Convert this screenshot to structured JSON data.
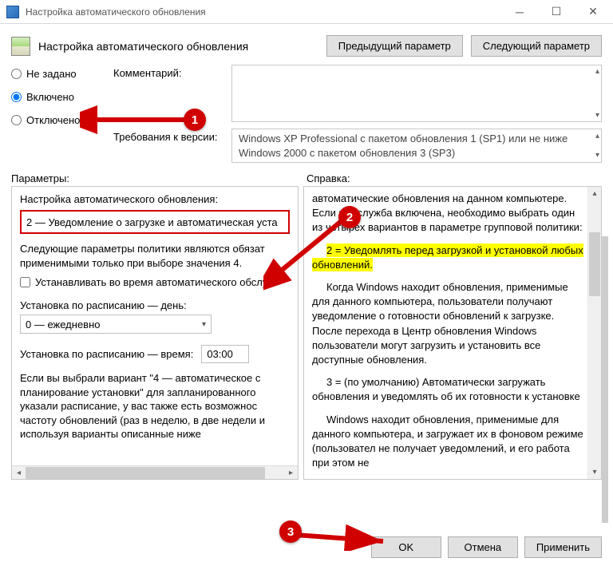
{
  "window": {
    "title": "Настройка автоматического обновления"
  },
  "header": {
    "policy_title": "Настройка автоматического обновления",
    "prev_button": "Предыдущий параметр",
    "next_button": "Следующий параметр"
  },
  "state": {
    "not_configured": "Не задано",
    "enabled": "Включено",
    "disabled": "Отключено",
    "selected": "enabled"
  },
  "fields": {
    "comment_label": "Комментарий:",
    "supported_label": "Требования к версии:",
    "supported_line1": "Windows XP Professional с пакетом обновления 1 (SP1) или не ниже",
    "supported_line2": "Windows 2000 с пакетом обновления 3 (SP3)"
  },
  "panes": {
    "options_label": "Параметры:",
    "help_label": "Справка:"
  },
  "options": {
    "dropdown_label": "Настройка автоматического обновления:",
    "dropdown_value": "2 — Уведомление о загрузке и автоматическая уста",
    "desc_line": "Следующие параметры политики являются обязат применимыми только при выборе значения 4.",
    "checkbox_label": "Устанавливать во время автоматического обслу",
    "day_label": "Установка по расписанию — день:",
    "day_value": "0 — ежедневно",
    "time_label": "Установка по расписанию — время:",
    "time_value": "03:00",
    "long_desc": "Если вы выбрали вариант \"4 — автоматическое с планирование установки\" для запланированного указали расписание, у вас также есть возможнос частоту обновлений (раз в неделю, в две недели и используя варианты  описанные ниже"
  },
  "help": {
    "p1": "автоматические обновления на данном компьютере. Если эта служба включена, необходимо выбрать один из четырех вариантов в параметре групповой политики:",
    "hl": "2 = Уведомлять перед загрузкой и установкой любых обновлений.",
    "p2": "Когда Windows находит обновления, применимые для данного компьютера, пользователи получают уведомление о готовности обновлений к загрузке. После перехода в Центр обновления Windows пользователи могут загрузить и установить все доступные обновления.",
    "p3": "3 = (по умолчанию) Автоматически загружать обновления и уведомлять об их готовности к установке",
    "p4": "Windows находит обновления, применимые для данного компьютера, и загружает их в фоновом режиме (пользовател не получает уведомлений, и его работа при этом не"
  },
  "footer": {
    "ok": "OK",
    "cancel": "Отмена",
    "apply": "Применить"
  },
  "annotations": {
    "b1": "1",
    "b2": "2",
    "b3": "3"
  }
}
